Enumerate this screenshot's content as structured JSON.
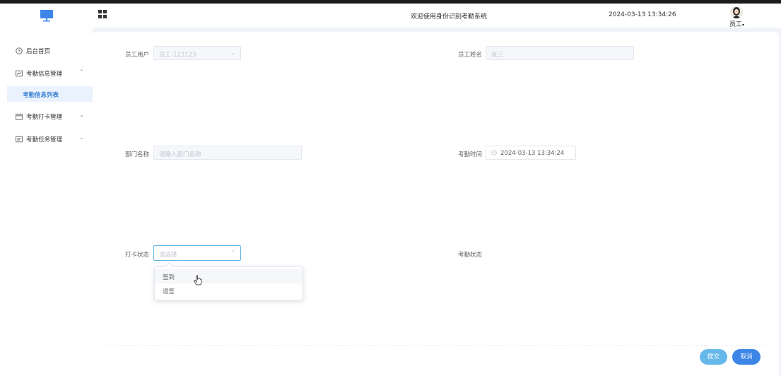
{
  "header": {
    "site_title": "欢迎使用身份识别考勤系统",
    "clock": "2024-03-13 13:34:26",
    "user_role": "员工",
    "caret": "▾",
    "brand_color": "#3d86e8"
  },
  "sidebar": {
    "items": [
      {
        "label": "后台首页",
        "icon": "clock-icon"
      },
      {
        "label": "考勤信息管理",
        "icon": "chart-icon",
        "arrow": "⌃"
      },
      {
        "label": "考勤打卡管理",
        "icon": "calendar-icon",
        "arrow": "⌄"
      },
      {
        "label": "考勤任务管理",
        "icon": "task-icon",
        "arrow": "⌄"
      }
    ],
    "active_sub_item": "考勤信息列表"
  },
  "form": {
    "employee_user": {
      "label": "员工用户",
      "value": "员工-123123",
      "chevron": "⌄"
    },
    "employee_name": {
      "label": "员工姓名",
      "value": "张三"
    },
    "department": {
      "label": "部门名称",
      "placeholder": "请输入部门名称"
    },
    "attendance_time": {
      "label": "考勤时间",
      "value": "2024-03-13 13:34:24"
    },
    "punch_status": {
      "label": "打卡状态",
      "placeholder": "请选择",
      "chevron": "⌃",
      "options": [
        "签到",
        "退签"
      ]
    },
    "attendance_status": {
      "label": "考勤状态"
    }
  },
  "actions": {
    "submit": "提交",
    "cancel": "取消"
  }
}
